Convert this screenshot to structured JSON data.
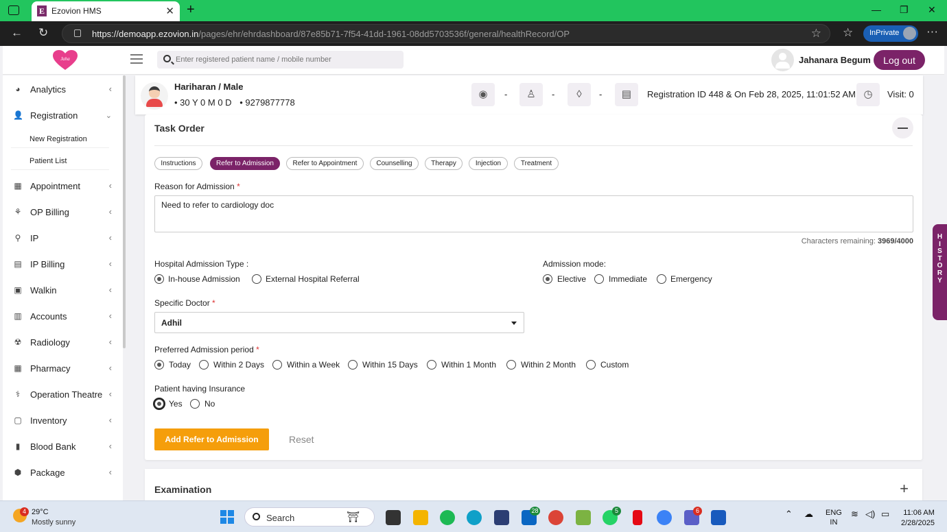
{
  "browser": {
    "tab_title": "Ezovion HMS",
    "favicon_letter": "E",
    "url_host": "https://demoapp.ezovion.in",
    "url_path": "/pages/ehr/ehrdashboard/87e85b71-7f54-41dd-1961-08dd5703536f/general/healthRecord/OP",
    "inprivate_label": "InPrivate"
  },
  "header": {
    "logo_text": "Jaha",
    "search_placeholder": "Enter registered patient name / mobile number",
    "user_name": "Jahanara Begum",
    "logout_label": "Log out",
    "accent_color": "#7b2368"
  },
  "sidebar": {
    "items": [
      {
        "label": "Analytics",
        "icon": "pie-chart-icon"
      },
      {
        "label": "Registration",
        "icon": "user-plus-icon",
        "expanded": true
      },
      {
        "label": "Appointment",
        "icon": "calendar-icon"
      },
      {
        "label": "OP Billing",
        "icon": "handshake-icon"
      },
      {
        "label": "IP",
        "icon": "walking-icon"
      },
      {
        "label": "IP Billing",
        "icon": "bill-icon"
      },
      {
        "label": "Walkin",
        "icon": "walkin-icon"
      },
      {
        "label": "Accounts",
        "icon": "accounts-icon"
      },
      {
        "label": "Radiology",
        "icon": "radiology-icon"
      },
      {
        "label": "Pharmacy",
        "icon": "pharmacy-icon"
      },
      {
        "label": "Operation Theatre",
        "icon": "operation-icon"
      },
      {
        "label": "Inventory",
        "icon": "inventory-icon"
      },
      {
        "label": "Blood Bank",
        "icon": "blood-bank-icon"
      },
      {
        "label": "Package",
        "icon": "package-icon"
      }
    ],
    "sub_items": [
      "New Registration",
      "Patient List"
    ]
  },
  "patient": {
    "name": "Hariharan / Male",
    "age": "30 Y 0 M 0 D",
    "phone": "9279877778",
    "vitals_dash": "-",
    "registration": "Registration ID 448 & On Feb 28, 2025, 11:01:52 AM",
    "visit": "Visit: 0"
  },
  "task_order": {
    "title": "Task Order",
    "chips": [
      "Instructions",
      "Refer to Admission",
      "Refer to Appointment",
      "Counselling",
      "Therapy",
      "Injection",
      "Treatment"
    ],
    "active_chip": "Refer to Admission",
    "reason_label": "Reason for Admission",
    "reason_value": "Need to refer to cardiology doc",
    "chars_remaining_label": "Characters remaining:",
    "chars_remaining_value": "3969/4000",
    "admission_type_label": "Hospital Admission Type :",
    "admission_type_options": [
      "In-house Admission",
      "External Hospital Referral"
    ],
    "admission_type_selected": "In-house Admission",
    "admission_mode_label": "Admission mode:",
    "admission_mode_options": [
      "Elective",
      "Immediate",
      "Emergency"
    ],
    "admission_mode_selected": "Elective",
    "doctor_label": "Specific Doctor",
    "doctor_value": "Adhil",
    "period_label": "Preferred Admission period",
    "period_options": [
      "Today",
      "Within 2 Days",
      "Within a Week",
      "Within 15 Days",
      "Within 1 Month",
      "Within 2 Month",
      "Custom"
    ],
    "period_selected": "Today",
    "insurance_label": "Patient having Insurance",
    "insurance_options": [
      "Yes",
      "No"
    ],
    "insurance_selected": "Yes",
    "add_button": "Add Refer to Admission",
    "reset_button": "Reset"
  },
  "examination": {
    "title": "Examination"
  },
  "history_tab": "HISTORY",
  "taskbar": {
    "weather_temp": "29°C",
    "weather_cond": "Mostly sunny",
    "weather_badge": "4",
    "search_label": "Search",
    "lang_1": "ENG",
    "lang_2": "IN",
    "time": "11:06 AM",
    "date": "2/28/2025",
    "badges": {
      "linkedin": "28",
      "whatsapp": "5",
      "teams": "6"
    }
  }
}
